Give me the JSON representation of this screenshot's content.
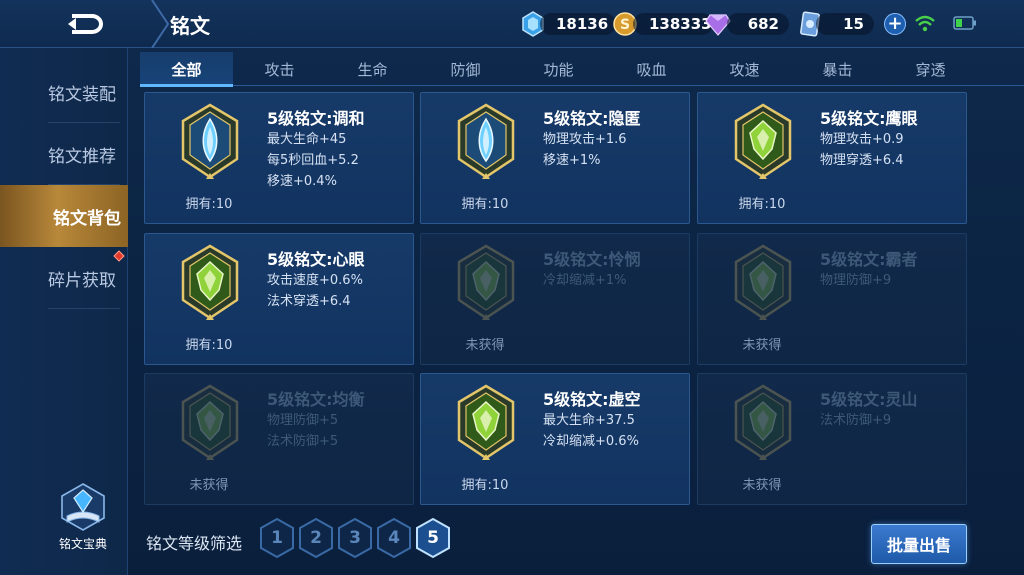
{
  "header": {
    "title": "铭文",
    "crystal": "18136",
    "gold": "138333",
    "diamond": "682",
    "voucher": "15"
  },
  "sidebar": {
    "items": [
      {
        "label": "铭文装配"
      },
      {
        "label": "铭文推荐"
      },
      {
        "label": "铭文背包"
      },
      {
        "label": "碎片获取"
      }
    ],
    "active_index": 2,
    "codex_label": "铭文宝典"
  },
  "tabs": [
    "全部",
    "攻击",
    "生命",
    "防御",
    "功能",
    "吸血",
    "攻速",
    "暴击",
    "穿透"
  ],
  "active_tab": 0,
  "runes": [
    {
      "name": "5级铭文:调和",
      "stats": [
        "最大生命+45",
        "每5秒回血+5.2",
        "移速+0.4%"
      ],
      "owned": "拥有:10",
      "color": "blue",
      "locked": false
    },
    {
      "name": "5级铭文:隐匿",
      "stats": [
        "物理攻击+1.6",
        "移速+1%"
      ],
      "owned": "拥有:10",
      "color": "blue",
      "locked": false
    },
    {
      "name": "5级铭文:鹰眼",
      "stats": [
        "物理攻击+0.9",
        "物理穿透+6.4"
      ],
      "owned": "拥有:10",
      "color": "green",
      "locked": false
    },
    {
      "name": "5级铭文:心眼",
      "stats": [
        "攻击速度+0.6%",
        "法术穿透+6.4"
      ],
      "owned": "拥有:10",
      "color": "green",
      "locked": false
    },
    {
      "name": "5级铭文:怜悯",
      "stats": [
        "冷却缩减+1%"
      ],
      "owned": "未获得",
      "color": "green",
      "locked": true
    },
    {
      "name": "5级铭文:霸者",
      "stats": [
        "物理防御+9"
      ],
      "owned": "未获得",
      "color": "green",
      "locked": true
    },
    {
      "name": "5级铭文:均衡",
      "stats": [
        "物理防御+5",
        "法术防御+5"
      ],
      "owned": "未获得",
      "color": "green",
      "locked": true
    },
    {
      "name": "5级铭文:虚空",
      "stats": [
        "最大生命+37.5",
        "冷却缩减+0.6%"
      ],
      "owned": "拥有:10",
      "color": "green",
      "locked": false
    },
    {
      "name": "5级铭文:灵山",
      "stats": [
        "法术防御+9"
      ],
      "owned": "未获得",
      "color": "green",
      "locked": true
    }
  ],
  "filter": {
    "label": "铭文等级筛选",
    "levels": [
      "1",
      "2",
      "3",
      "4",
      "5"
    ],
    "active_level": "5"
  },
  "sell_button": "批量出售",
  "colors": {
    "accent": "#5fb8ff",
    "active_side": "#b8883a",
    "gem_blue": "#6fd0ff",
    "gem_green": "#8fd23a",
    "gem_gold": "#e3c56a"
  }
}
